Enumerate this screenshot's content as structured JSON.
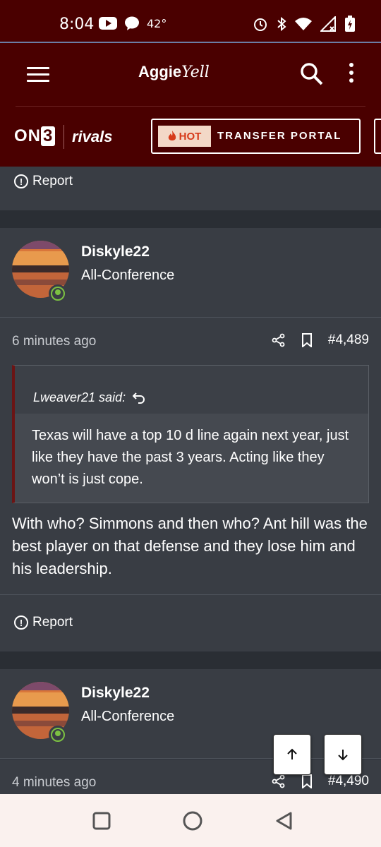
{
  "status_bar": {
    "time": "8:04",
    "temperature": "42°",
    "icons_left": [
      "youtube-icon",
      "message-bubble-icon"
    ],
    "icons_right": [
      "alarm-icon",
      "bluetooth-icon",
      "wifi-icon",
      "signal-icon",
      "battery-charging-icon"
    ]
  },
  "app_bar": {
    "logo_main": "Aggie",
    "logo_script": "Yell",
    "icons": [
      "menu-icon",
      "search-icon",
      "more-vertical-icon"
    ]
  },
  "brand_bar": {
    "on3_prefix": "ON",
    "on3_box": "3",
    "rivals": "rivals",
    "hot_label": "HOT",
    "transfer_portal_label": "TRANSFER PORTAL"
  },
  "posts": [
    {
      "report_label": "Report"
    },
    {
      "username": "Diskyle22",
      "rank": "All-Conference",
      "time_ago": "6 minutes ago",
      "post_number": "#4,489",
      "quote": {
        "author": "Lweaver21 said:",
        "text": "Texas will have a top 10 d line again next year, just like they have the past 3 years. Acting like they won’t is just cope."
      },
      "body": "With who? Simmons and then who? Ant hill was the best player on that defense and they lose him and his leadership.",
      "report_label": "Report"
    },
    {
      "username": "Diskyle22",
      "rank": "All-Conference",
      "time_ago": "4 minutes ago",
      "post_number": "#4,490"
    }
  ],
  "colors": {
    "header_bg": "#4a0000",
    "post_bg": "#393d44",
    "online_green": "#7cc142",
    "hot_red": "#d63a1a"
  }
}
